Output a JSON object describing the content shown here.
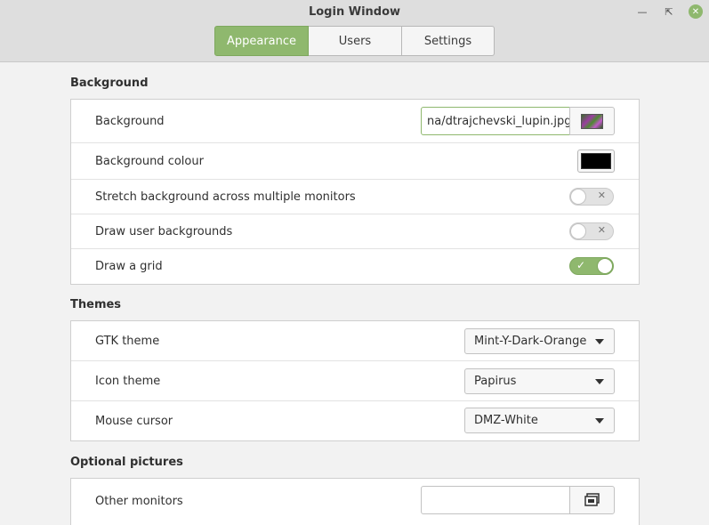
{
  "window": {
    "title": "Login Window"
  },
  "tabs": [
    {
      "label": "Appearance",
      "active": true
    },
    {
      "label": "Users",
      "active": false
    },
    {
      "label": "Settings",
      "active": false
    }
  ],
  "sections": {
    "background": {
      "title": "Background",
      "rows": {
        "background": {
          "label": "Background",
          "value": "na/dtrajchevski_lupin.jpg"
        },
        "background_colour": {
          "label": "Background colour",
          "color": "#000000"
        },
        "stretch": {
          "label": "Stretch background across multiple monitors",
          "enabled": false
        },
        "user_backgrounds": {
          "label": "Draw user backgrounds",
          "enabled": false
        },
        "grid": {
          "label": "Draw a grid",
          "enabled": true
        }
      }
    },
    "themes": {
      "title": "Themes",
      "rows": {
        "gtk": {
          "label": "GTK theme",
          "value": "Mint-Y-Dark-Orange"
        },
        "icon": {
          "label": "Icon theme",
          "value": "Papirus"
        },
        "cursor": {
          "label": "Mouse cursor",
          "value": "DMZ-White"
        }
      }
    },
    "optional_pictures": {
      "title": "Optional pictures",
      "rows": {
        "other_monitors": {
          "label": "Other monitors",
          "value": ""
        }
      }
    }
  },
  "colors": {
    "accent": "#8fb86e",
    "header_bg": "#dedede",
    "page_bg": "#f2f2f2"
  },
  "icons": {
    "minimize": "minimize-icon",
    "restore": "restore-icon",
    "close": "close-icon",
    "check": "check-icon",
    "cross": "cross-icon",
    "file_chooser": "file-chooser-icon"
  }
}
